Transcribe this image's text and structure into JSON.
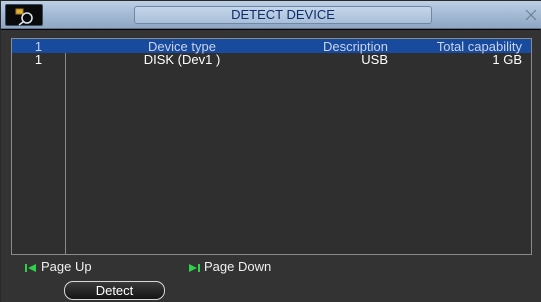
{
  "window": {
    "title": "DETECT DEVICE"
  },
  "table": {
    "headers": [
      "1",
      "Device type",
      "Description",
      "Total capability"
    ],
    "rows": [
      {
        "index": "1",
        "device_type": "DISK (Dev1 )",
        "description": "USB",
        "capacity": "1 GB"
      }
    ]
  },
  "navigation": {
    "page_up": "Page Up",
    "page_down": "Page Down"
  },
  "actions": {
    "detect": "Detect"
  },
  "colors": {
    "header_bg": "#184a9e",
    "title_bar": "#a6bcd6",
    "panel_bg": "#333333",
    "nav_arrow": "#2ed24a"
  }
}
